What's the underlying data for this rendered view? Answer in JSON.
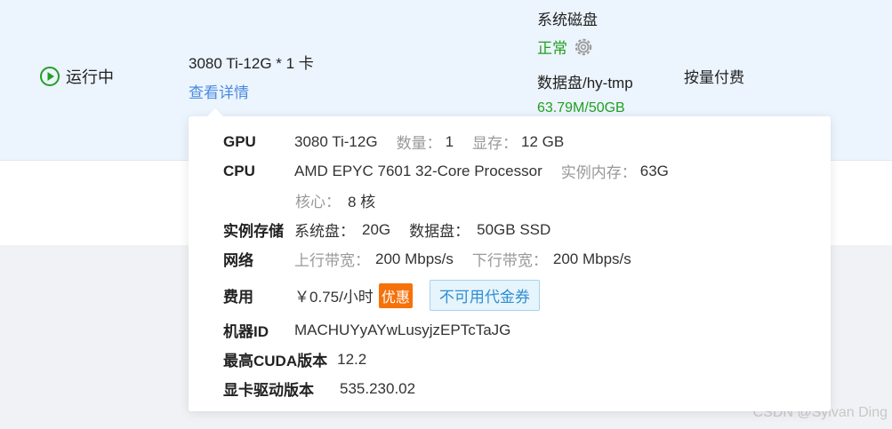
{
  "instance": {
    "status_text": "运行中",
    "gpu_summary": "3080 Ti-12G * 1 卡",
    "details_link": "查看详情",
    "system_disk_label": "系统磁盘",
    "system_disk_status": "正常",
    "data_disk_label": "数据盘/hy-tmp",
    "data_disk_usage": "63.79M/50GB",
    "billing_mode": "按量付费"
  },
  "popover": {
    "gpu": {
      "key": "GPU",
      "model": "3080 Ti-12G",
      "count_label": "数量：",
      "count": "1",
      "vram_label": "显存：",
      "vram": "12 GB"
    },
    "cpu": {
      "key": "CPU",
      "model": "AMD EPYC 7601 32-Core Processor",
      "mem_label": "实例内存：",
      "mem": "63G",
      "cores_label": "核心：",
      "cores": "8 核"
    },
    "storage": {
      "key": "实例存储",
      "sys_label": "系统盘：",
      "sys": "20G",
      "data_label": "数据盘：",
      "data": "50GB SSD"
    },
    "network": {
      "key": "网络",
      "up_label": "上行带宽：",
      "up": "200 Mbps/s",
      "down_label": "下行带宽：",
      "down": "200 Mbps/s"
    },
    "cost": {
      "key": "费用",
      "price": "￥0.75/小时",
      "discount_badge": "优惠",
      "voucher_badge": "不可用代金券"
    },
    "machine_id": {
      "key": "机器ID",
      "value": "MACHUYyAYwLusyjzEPTcTaJG"
    },
    "cuda": {
      "key": "最高CUDA版本",
      "value": "12.2"
    },
    "driver": {
      "key": "显卡驱动版本",
      "value": "535.230.02"
    }
  },
  "watermark": "CSDN @Sylvan Ding",
  "colors": {
    "accent_blue": "#4a8be0",
    "status_green": "#22a022",
    "discount_orange": "#f5720b"
  },
  "icons": {
    "status": "play-circle-icon",
    "settings": "gear-icon"
  }
}
